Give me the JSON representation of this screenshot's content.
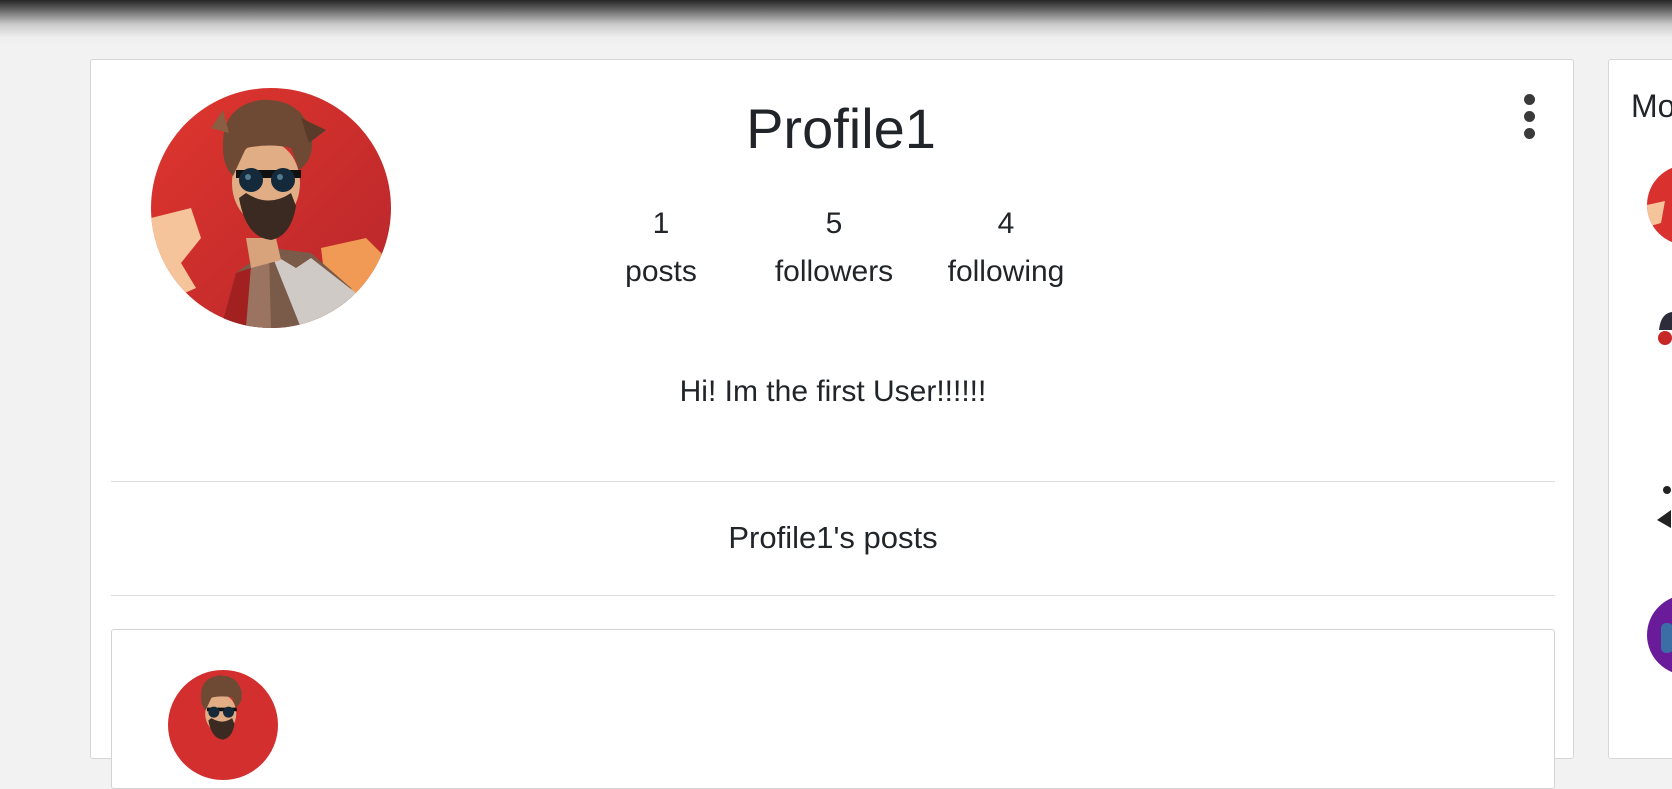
{
  "profile": {
    "username": "Profile1",
    "stats": [
      {
        "value": "1",
        "label": "posts"
      },
      {
        "value": "5",
        "label": "followers"
      },
      {
        "value": "4",
        "label": "following"
      }
    ],
    "bio": "Hi! Im the first User!!!!!!",
    "posts_heading": "Profile1's posts",
    "more_options_icon": "vertical-ellipsis-icon"
  },
  "sidebar": {
    "title": "Mo"
  },
  "colors": {
    "avatar_background": "#d9322e",
    "avatar_background_dark": "#b8262b",
    "avatar_accent": "#f2a15c",
    "side_avatar_purple": "#6a1b9a",
    "divider": "#dcdcdc"
  }
}
